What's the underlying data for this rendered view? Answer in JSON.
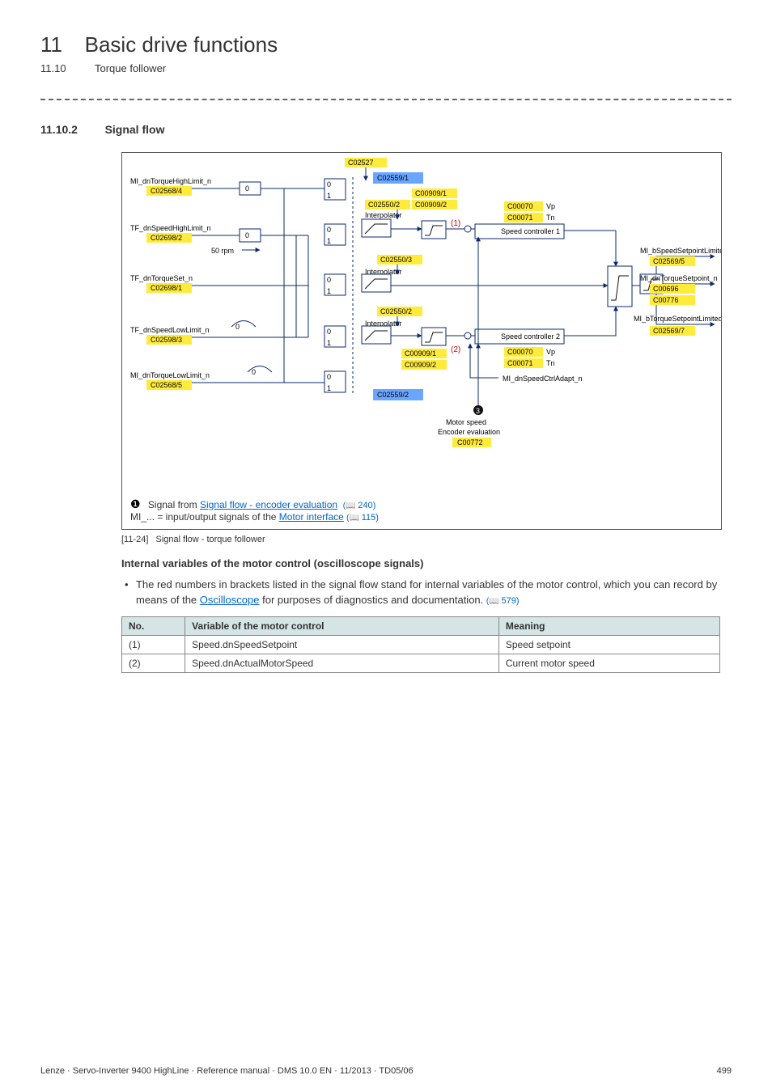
{
  "chapter": {
    "number": "11",
    "title": "Basic drive functions"
  },
  "subheader": {
    "number": "11.10",
    "title": "Torque follower"
  },
  "section": {
    "number": "11.10.2",
    "title": "Signal flow"
  },
  "fig": {
    "id": "[11-24]",
    "caption": "Signal flow - torque follower",
    "note1_prefix": "Signal from ",
    "note1_link": "Signal flow - encoder evaluation",
    "note1_ref": "240",
    "note2_prefix": "MI_... = input/output signals of the ",
    "note2_link": "Motor interface",
    "note2_ref": "115"
  },
  "subhead": "Internal variables of the motor control (oscilloscope signals)",
  "body": {
    "text_a": "The red numbers in brackets listed in the signal flow stand for internal variables of the motor control, which you can record by means of the ",
    "osc_link": "Oscilloscope",
    "text_b": " for purposes of diagnostics and documentation. ",
    "body_ref": "579"
  },
  "table": {
    "h1": "No.",
    "h2": "Variable of the motor control",
    "h3": "Meaning",
    "r1c1": "(1)",
    "r1c2": "Speed.dnSpeedSetpoint",
    "r1c3": "Speed setpoint",
    "r2c1": "(2)",
    "r2c2": "Speed.dnActualMotorSpeed",
    "r2c3": "Current motor speed"
  },
  "footer": {
    "left": "Lenze · Servo-Inverter 9400 HighLine · Reference manual · DMS 10.0 EN · 11/2013 · TD05/06",
    "right": "499"
  },
  "diagram": {
    "inL1": "MI_dnTorqueHighLimit_n",
    "inL1c": "C02568/4",
    "inL2": "TF_dnSpeedHighLimit_n",
    "inL2c": "C02698/2",
    "inL3": "TF_dnTorqueSet_n",
    "inL3c": "C02698/1",
    "inL4": "TF_dnSpeedLowLimit_n",
    "inL4c": "C02598/3",
    "inL5": "MI_dnTorqueLowLimit_n",
    "inL5c": "C02568/5",
    "fifty": "50 rpm",
    "interp": "Interpolator",
    "top": "C02527",
    "dnsc": "MI_dnSpeedCtrlAdapt_n",
    "me1": "Motor speed",
    "me2": "Encoder evaluation",
    "spc1": "Speed controller 1",
    "spc2": "Speed controller 2",
    "vp": "Vp",
    "tn": "Tn",
    "c2": "C02559/1",
    "c3a": "C00909/1",
    "c3b": "C02550/2",
    "c3c": "C00909/2",
    "c7": "C02550/3",
    "c8": "C02550/2",
    "c9": "C02559/2",
    "c10a": "C00909/1",
    "c10b": "C00909/2",
    "vp1": "C00070",
    "tn1": "C00071",
    "vp2": "C00070",
    "tn2": "C00071",
    "motc": "C00772",
    "outA": "MI_bSpeedSetpointLimited",
    "outAc": "C02569/5",
    "outB": "MI_dnTorqueSetpoint_n",
    "outBc1": "C00696",
    "outBc2": "C00776",
    "outC": "MI_bTorqueSetpointLimited",
    "outCc": "C02569/7",
    "red1": "(1)",
    "red2": "(2)",
    "bullet3": "3"
  }
}
